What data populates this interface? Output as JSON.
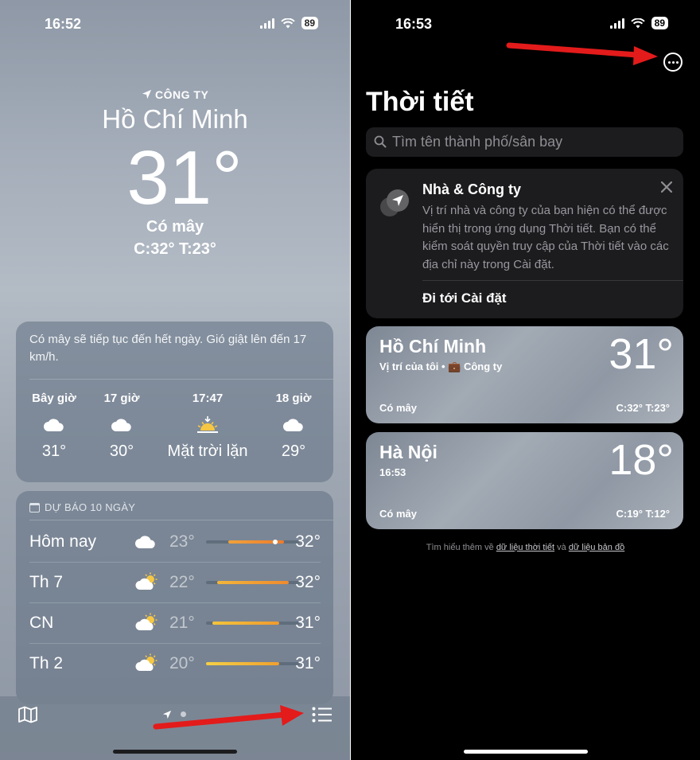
{
  "left": {
    "status_time": "16:52",
    "battery": "89",
    "location_label": "CÔNG TY",
    "city": "Hồ Chí Minh",
    "temperature": "31°",
    "condition": "Có mây",
    "high_low": "C:32°  T:23°",
    "hourly_summary": "Có mây sẽ tiếp tục đến hết ngày. Gió giật lên đến 17 km/h.",
    "hourly": [
      {
        "label": "Bây giờ",
        "icon": "cloud-icon",
        "value": "31°"
      },
      {
        "label": "17 giờ",
        "icon": "cloud-icon",
        "value": "30°"
      },
      {
        "label": "17:47",
        "icon": "sunset-icon",
        "value": "Mặt trời lặn"
      },
      {
        "label": "18 giờ",
        "icon": "cloud-icon",
        "value": "29°"
      }
    ],
    "forecast_title": "DỰ BÁO 10 NGÀY",
    "daily": [
      {
        "day": "Hôm nay",
        "icon": "cloud-icon",
        "low": "23°",
        "high": "32°"
      },
      {
        "day": "Th 7",
        "icon": "partly-sunny-icon",
        "low": "22°",
        "high": "32°"
      },
      {
        "day": "CN",
        "icon": "partly-sunny-icon",
        "low": "21°",
        "high": "31°"
      },
      {
        "day": "Th 2",
        "icon": "partly-sunny-icon",
        "low": "20°",
        "high": "31°"
      }
    ]
  },
  "right": {
    "status_time": "16:53",
    "battery": "89",
    "title": "Thời tiết",
    "search_placeholder": "Tìm tên thành phố/sân bay",
    "info_card": {
      "title": "Nhà & Công ty",
      "body": "Vị trí nhà và công ty của bạn hiện có thể được hiển thị trong ứng dụng Thời tiết. Bạn có thể kiểm soát quyền truy cập của Thời tiết vào các địa chỉ này trong Cài đặt.",
      "link": "Đi tới Cài đặt"
    },
    "locations": [
      {
        "city": "Hồ Chí Minh",
        "subtitle": "Vị trí của tôi • 💼 Công ty",
        "temp": "31°",
        "condition": "Có mây",
        "high_low": "C:32°  T:23°"
      },
      {
        "city": "Hà Nội",
        "subtitle": "16:53",
        "temp": "18°",
        "condition": "Có mây",
        "high_low": "C:19°  T:12°"
      }
    ],
    "footer_prefix": "Tìm hiểu thêm về",
    "footer_link1": "dữ liệu thời tiết",
    "footer_and": "và",
    "footer_link2": "dữ liệu bản đồ"
  },
  "colors": {
    "arrow_red": "#e31b1b",
    "bar_orange": "#f0922e",
    "bar_yellow": "#f3c53b"
  }
}
